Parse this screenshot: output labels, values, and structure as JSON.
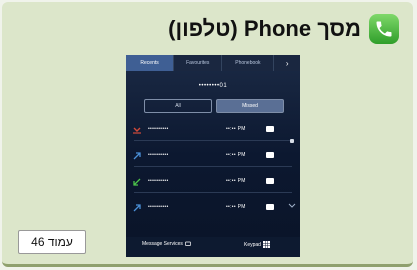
{
  "page": {
    "title": "מסך Phone (טלפון)",
    "page_label": "עמוד 46"
  },
  "colors": {
    "accent": "#3f5f94",
    "missed": "#d24a3a",
    "incoming": "#4cc24a",
    "outgoing": "#4a8fd6"
  },
  "tabs": [
    {
      "label": "Recents",
      "active": true
    },
    {
      "label": "Favourites",
      "active": false
    },
    {
      "label": "Phonebook",
      "active": false
    },
    {
      "label": "›",
      "active": false
    }
  ],
  "dialed_number": "••••••••01",
  "filter": {
    "all": "All",
    "missed": "Missed",
    "active": "missed"
  },
  "calls": [
    {
      "number": "••••••••••",
      "time": "••:•• PM",
      "icon": "missed-call-icon"
    },
    {
      "number": "••••••••••",
      "time": "••:•• PM",
      "icon": "outgoing-call-icon"
    },
    {
      "number": "••••••••••",
      "time": "••:•• PM",
      "icon": "incoming-call-icon"
    },
    {
      "number": "••••••••••",
      "time": "••:•• PM",
      "icon": "outgoing-call-icon"
    }
  ],
  "bottom_bar": {
    "left_label": "Message Services",
    "right_label": "Keypad"
  }
}
